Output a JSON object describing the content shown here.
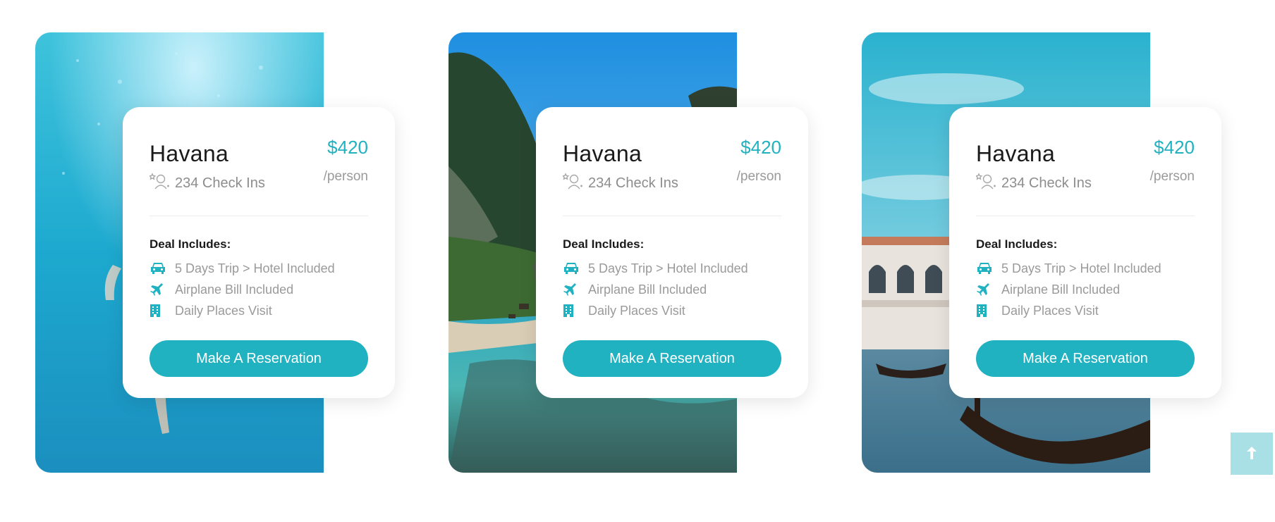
{
  "deals": [
    {
      "city": "Havana",
      "checkins": "234 Check Ins",
      "price": "$420",
      "unit": "/person",
      "deal_title": "Deal Includes:",
      "features": [
        {
          "icon": "taxi-icon",
          "text": "5 Days Trip > Hotel Included"
        },
        {
          "icon": "airplane-icon",
          "text": "Airplane Bill Included"
        },
        {
          "icon": "building-icon",
          "text": "Daily Places Visit"
        }
      ],
      "button": "Make A Reservation",
      "photo": "underwater-diver"
    },
    {
      "city": "Havana",
      "checkins": "234 Check Ins",
      "price": "$420",
      "unit": "/person",
      "deal_title": "Deal Includes:",
      "features": [
        {
          "icon": "taxi-icon",
          "text": "5 Days Trip > Hotel Included"
        },
        {
          "icon": "airplane-icon",
          "text": "Airplane Bill Included"
        },
        {
          "icon": "building-icon",
          "text": "Daily Places Visit"
        }
      ],
      "button": "Make A Reservation",
      "photo": "tropical-island-coast"
    },
    {
      "city": "Havana",
      "checkins": "234 Check Ins",
      "price": "$420",
      "unit": "/person",
      "deal_title": "Deal Includes:",
      "features": [
        {
          "icon": "taxi-icon",
          "text": "5 Days Trip > Hotel Included"
        },
        {
          "icon": "airplane-icon",
          "text": "Airplane Bill Included"
        },
        {
          "icon": "building-icon",
          "text": "Daily Places Visit"
        }
      ],
      "button": "Make A Reservation",
      "photo": "venice-gondola-canal"
    }
  ],
  "scroll_top": {
    "icon": "arrow-up-icon"
  },
  "colors": {
    "accent": "#20b2c0",
    "scroll_button": "#a9e0e5",
    "muted_text": "#9a9a9a",
    "heading_text": "#1a1a1a"
  }
}
